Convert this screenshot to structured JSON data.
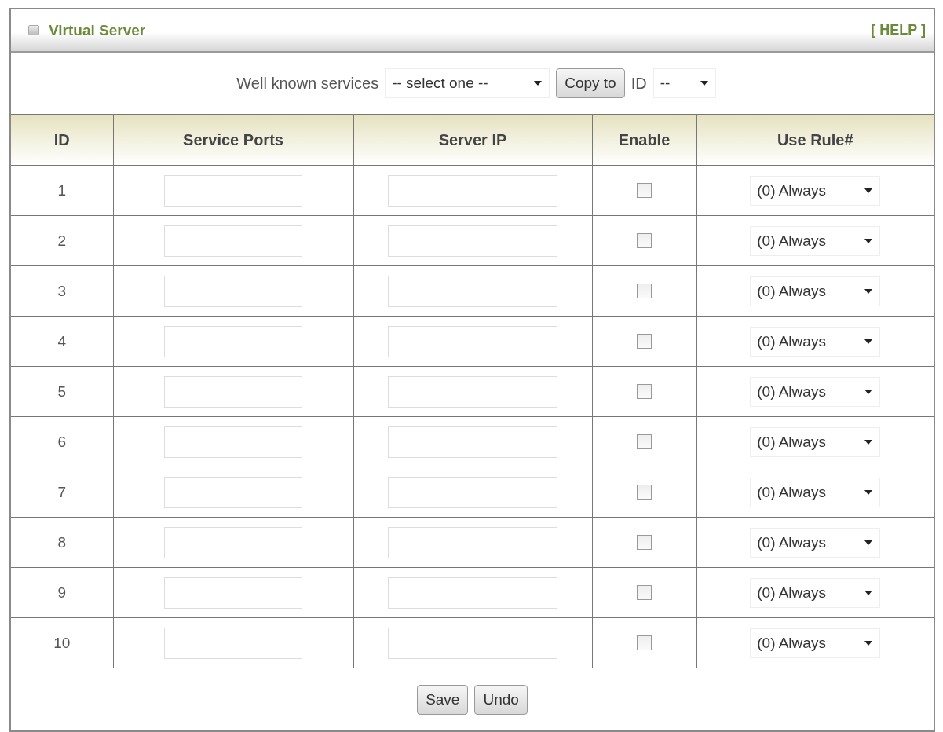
{
  "panel": {
    "title": "Virtual Server",
    "help_link": "[ HELP ]"
  },
  "toolbar": {
    "label": "Well known services",
    "services_select": "-- select one --",
    "copy_button": "Copy to",
    "id_label": "ID",
    "id_select": "--"
  },
  "table": {
    "columns": [
      "ID",
      "Service Ports",
      "Server IP",
      "Enable",
      "Use Rule#"
    ],
    "rows": [
      {
        "id": "1",
        "enabled": false,
        "rule": "(0) Always"
      },
      {
        "id": "2",
        "enabled": false,
        "rule": "(0) Always"
      },
      {
        "id": "3",
        "enabled": false,
        "rule": "(0) Always"
      },
      {
        "id": "4",
        "enabled": false,
        "rule": "(0) Always"
      },
      {
        "id": "5",
        "enabled": false,
        "rule": "(0) Always"
      },
      {
        "id": "6",
        "enabled": false,
        "rule": "(0) Always"
      },
      {
        "id": "7",
        "enabled": false,
        "rule": "(0) Always"
      },
      {
        "id": "8",
        "enabled": false,
        "rule": "(0) Always"
      },
      {
        "id": "9",
        "enabled": false,
        "rule": "(0) Always"
      },
      {
        "id": "10",
        "enabled": false,
        "rule": "(0) Always"
      }
    ]
  },
  "buttons": [
    "Save",
    "Undo"
  ]
}
